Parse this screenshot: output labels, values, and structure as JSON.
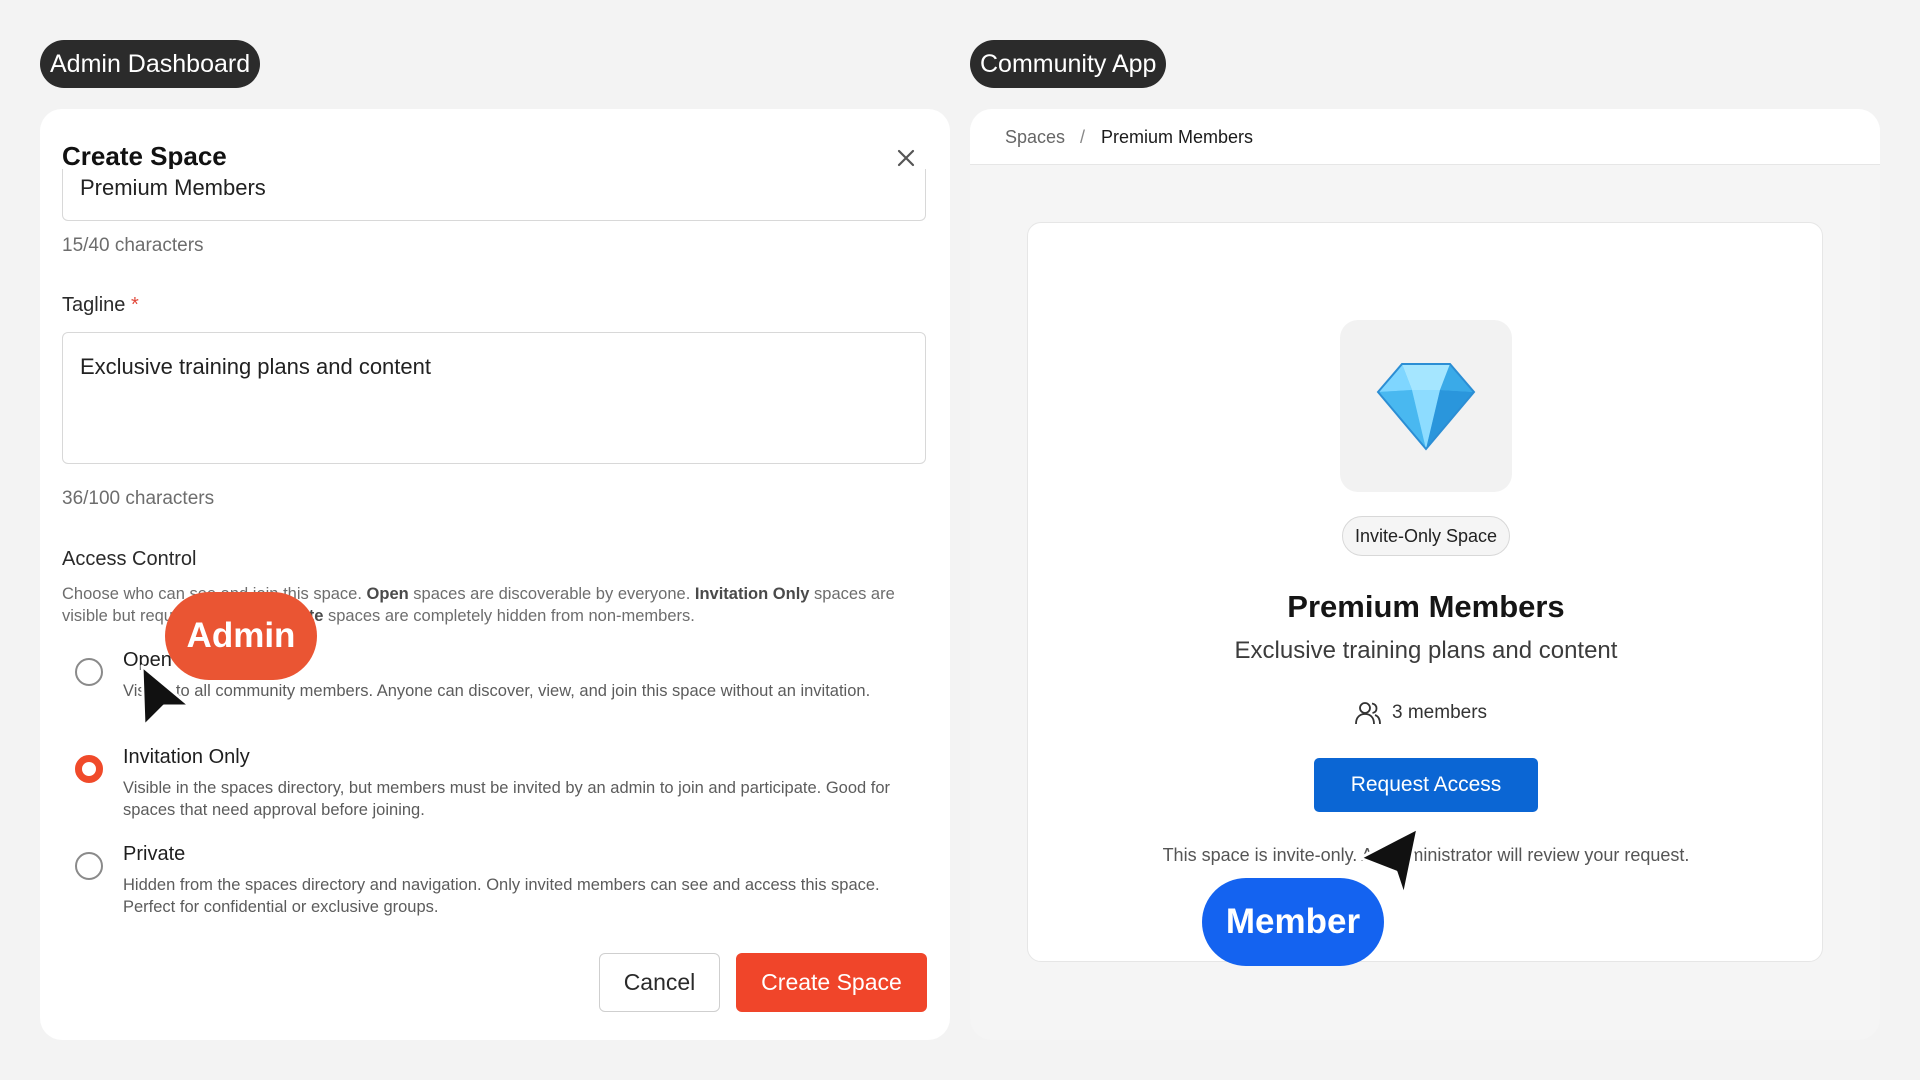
{
  "labels": {
    "left": "Admin Dashboard",
    "right": "Community App"
  },
  "dialog": {
    "title": "Create Space",
    "name_value": "Premium Members",
    "name_count": "15/40 characters",
    "tagline_label": "Tagline",
    "tagline_required": "*",
    "tagline_value": "Exclusive training plans and content",
    "tagline_count": "36/100 characters",
    "access_label": "Access Control",
    "access_desc": {
      "p1": "Choose who can see and join this space. ",
      "open": "Open",
      "p2": " spaces are discoverable by everyone. ",
      "invite": "Invitation Only",
      "p3": " spaces are visible but require approval. ",
      "private": "Private",
      "p4": " spaces are completely hidden from non-members."
    },
    "options": [
      {
        "title": "Open",
        "desc": "Visible to all community members. Anyone can discover, view, and join this space without an invitation.",
        "selected": false
      },
      {
        "title": "Invitation Only",
        "desc": "Visible in the spaces directory, but members must be invited by an admin to join and participate. Good for spaces that need approval before joining.",
        "selected": true
      },
      {
        "title": "Private",
        "desc": "Hidden from the spaces directory and navigation. Only invited members can see and access this space. Perfect for confidential or exclusive groups.",
        "selected": false
      }
    ],
    "cancel_label": "Cancel",
    "create_label": "Create Space"
  },
  "community": {
    "breadcrumb": {
      "parent": "Spaces",
      "separator": "/",
      "current": "Premium Members"
    },
    "icon": "gem-icon",
    "badge": "Invite-Only Space",
    "title": "Premium Members",
    "tagline": "Exclusive training plans and content",
    "members": "3 members",
    "request_label": "Request Access",
    "note": "This space is invite-only. An administrator will review your request."
  },
  "overlays": {
    "admin": "Admin",
    "member": "Member"
  },
  "colors": {
    "accent_orange": "#f0452a",
    "accent_blue": "#0b66d4",
    "member_bubble": "#1463f0",
    "admin_bubble": "#ea5533"
  }
}
